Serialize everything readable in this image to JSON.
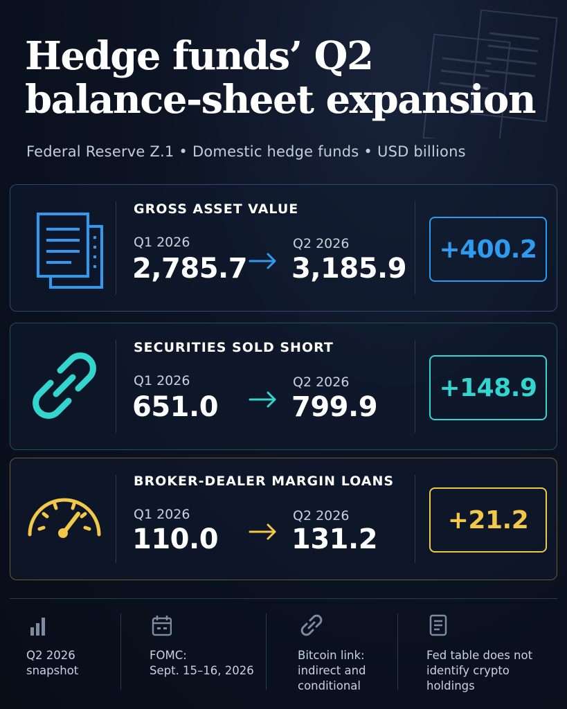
{
  "title": {
    "line1": "Hedge funds’ Q2",
    "line2": "balance-sheet expansion"
  },
  "subtitle": {
    "source": "Federal Reserve Z.1",
    "scope": "Domestic hedge funds",
    "unit": "USD billions",
    "separator": "•"
  },
  "colors": {
    "blue": "#2f9bf0",
    "teal": "#33d6cf",
    "gold": "#f2c84b"
  },
  "cards": [
    {
      "icon": "document-icon",
      "label": "GROSS ASSET VALUE",
      "q1_label": "Q1 2026",
      "q1_value": "2,785.7",
      "q2_label": "Q2 2026",
      "q2_value": "3,185.9",
      "delta": "+400.2"
    },
    {
      "icon": "chain-link-icon",
      "label": "SECURITIES SOLD SHORT",
      "q1_label": "Q1 2026",
      "q1_value": "651.0",
      "q2_label": "Q2 2026",
      "q2_value": "799.9",
      "delta": "+148.9"
    },
    {
      "icon": "gauge-icon",
      "label": "BROKER-DEALER MARGIN LOANS",
      "q1_label": "Q1 2026",
      "q1_value": "110.0",
      "q2_label": "Q2 2026",
      "q2_value": "131.2",
      "delta": "+21.2"
    }
  ],
  "footer": [
    {
      "icon": "bar-chart-icon",
      "text": "Q2 2026\nsnapshot"
    },
    {
      "icon": "calendar-icon",
      "text": "FOMC:\nSept. 15–16, 2026"
    },
    {
      "icon": "link-icon",
      "text": "Bitcoin link:\nindirect and\nconditional"
    },
    {
      "icon": "document-icon",
      "text": "Fed table does not\nidentify crypto\nholdings"
    }
  ]
}
